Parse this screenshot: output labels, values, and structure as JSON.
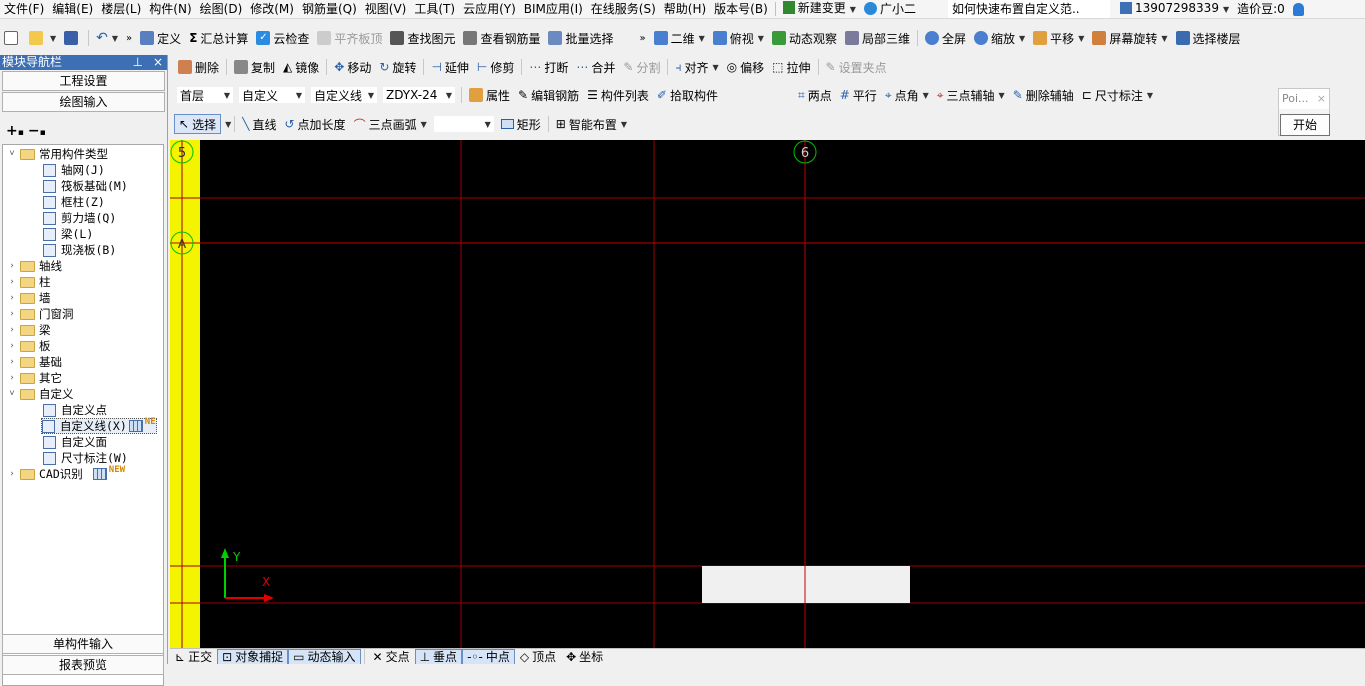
{
  "menu": {
    "items": [
      "文件(F)",
      "编辑(E)",
      "楼层(L)",
      "构件(N)",
      "绘图(D)",
      "修改(M)",
      "钢筋量(Q)",
      "视图(V)",
      "工具(T)",
      "云应用(Y)",
      "BIM应用(I)",
      "在线服务(S)",
      "帮助(H)",
      "版本号(B)"
    ],
    "new_change": "新建变更",
    "assistant": "广小二",
    "search_text": "如何快速布置自定义范..",
    "user": "13907298339",
    "beans": "造价豆:0"
  },
  "toolbar1": {
    "define": "定义",
    "sum_calc": "汇总计算",
    "cloud_check": "云检查",
    "flat_slab_top": "平齐板顶",
    "find_element": "查找图元",
    "view_rebar": "查看钢筋量",
    "batch_select": "批量选择",
    "view_2d": "二维",
    "top_view": "俯视",
    "dynamic_view": "动态观察",
    "local_3d": "局部三维",
    "full_screen": "全屏",
    "zoom": "缩放",
    "pan": "平移",
    "screen_rotate": "屏幕旋转",
    "select_floor": "选择楼层"
  },
  "toolbar2": {
    "delete": "删除",
    "copy": "复制",
    "mirror": "镜像",
    "move": "移动",
    "rotate": "旋转",
    "extend": "延伸",
    "trim": "修剪",
    "break": "打断",
    "merge": "合并",
    "split": "分割",
    "align": "对齐",
    "offset": "偏移",
    "stretch": "拉伸",
    "set_grip": "设置夹点"
  },
  "toolbar3": {
    "floor": "首层",
    "category": "自定义",
    "element_type": "自定义线",
    "element_name": "ZDYX-24",
    "properties": "属性",
    "edit_rebar": "编辑钢筋",
    "element_list": "构件列表",
    "pick_element": "拾取构件",
    "two_points": "两点",
    "parallel": "平行",
    "point_angle": "点角",
    "three_point_aux": "三点辅轴",
    "delete_aux": "删除辅轴",
    "dimension": "尺寸标注"
  },
  "toolbar4": {
    "select": "选择",
    "line": "直线",
    "point_length": "点加长度",
    "three_point_arc": "三点画弧",
    "rect": "矩形",
    "smart_layout": "智能布置"
  },
  "nav": {
    "title": "模块导航栏",
    "pin": "ᵖ",
    "close": "×",
    "section_project": "工程设置",
    "section_drawing": "绘图输入",
    "section_single": "单构件输入",
    "section_report": "报表预览",
    "tree": {
      "common": "常用构件类型",
      "common_children": [
        "轴网(J)",
        "筏板基础(M)",
        "框柱(Z)",
        "剪力墙(Q)",
        "梁(L)",
        "现浇板(B)"
      ],
      "folders": [
        "轴线",
        "柱",
        "墙",
        "门窗洞",
        "梁",
        "板",
        "基础",
        "其它"
      ],
      "custom": "自定义",
      "custom_children": [
        "自定义点",
        "自定义线(X)",
        "自定义面",
        "尺寸标注(W)"
      ],
      "cad": "CAD识别",
      "new_badge": "NEW",
      "ne_badge": "NE"
    }
  },
  "canvas": {
    "axis_top": "6",
    "axis_left_top": "5",
    "axis_left_mid": "A",
    "axis_y": "Y",
    "axis_x": "X"
  },
  "popup": {
    "title": "Poi...",
    "start": "开始"
  },
  "status": {
    "ortho": "正交",
    "snap": "对象捕捉",
    "dyn_input": "动态输入",
    "intersect": "交点",
    "perp": "垂点",
    "mid": "中点",
    "vertex": "顶点",
    "coord": "坐标"
  },
  "colors": {
    "canvas_bg": "#000000",
    "grid_line": "#a00000",
    "axis_circle": "#00c000",
    "left_strip": "#f4f400",
    "nav_title": "#3c6fb3"
  }
}
